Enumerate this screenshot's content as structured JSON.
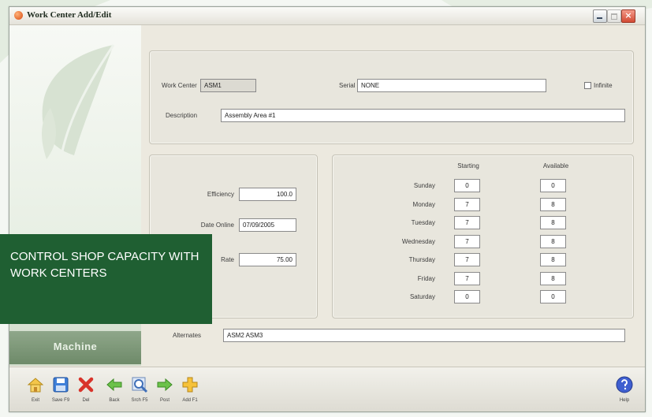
{
  "window": {
    "title": "Work Center Add/Edit",
    "controls": {
      "minimize": "minimize",
      "maximize": "maximize",
      "close": "×"
    }
  },
  "sidebar": {
    "label": "Machine"
  },
  "header_panel": {
    "work_center_label": "Work Center",
    "work_center_value": "ASM1",
    "serial_label": "Serial",
    "serial_value": "NONE",
    "infinite_label": "Infinite",
    "infinite_checked": false,
    "description_label": "Description",
    "description_value": "Assembly Area #1"
  },
  "details_panel": {
    "efficiency_label": "Efficiency",
    "efficiency_value": "100.0",
    "date_online_label": "Date Online",
    "date_online_value": "07/09/2005",
    "rate_label": "Rate",
    "rate_value": "75.00"
  },
  "schedule": {
    "starting_header": "Starting",
    "available_header": "Available",
    "days": [
      {
        "day": "Sunday",
        "starting": "0",
        "available": "0"
      },
      {
        "day": "Monday",
        "starting": "7",
        "available": "8"
      },
      {
        "day": "Tuesday",
        "starting": "7",
        "available": "8"
      },
      {
        "day": "Wednesday",
        "starting": "7",
        "available": "8"
      },
      {
        "day": "Thursday",
        "starting": "7",
        "available": "8"
      },
      {
        "day": "Friday",
        "starting": "7",
        "available": "8"
      },
      {
        "day": "Saturday",
        "starting": "0",
        "available": "0"
      }
    ]
  },
  "alternates": {
    "label": "Alternates",
    "value": "ASM2 ASM3"
  },
  "toolbar": {
    "buttons": [
      {
        "label": "Exit",
        "icon": "home-icon"
      },
      {
        "label": "Save F9",
        "icon": "save-icon"
      },
      {
        "label": "Del",
        "icon": "delete-x-icon"
      },
      {
        "label": "Back",
        "icon": "back-arrow-icon"
      },
      {
        "label": "Srch F5",
        "icon": "search-icon"
      },
      {
        "label": "Post",
        "icon": "forward-arrow-icon"
      },
      {
        "label": "Add F1",
        "icon": "add-plus-icon"
      }
    ],
    "help_label": "Help"
  },
  "overlay": {
    "text": "CONTROL SHOP CAPACITY WITH WORK CENTERS"
  },
  "colors": {
    "overlay_bg": "#1f5f32",
    "panel_bg": "#e8e6dd",
    "sidebar_accent": "#6e8a69"
  }
}
